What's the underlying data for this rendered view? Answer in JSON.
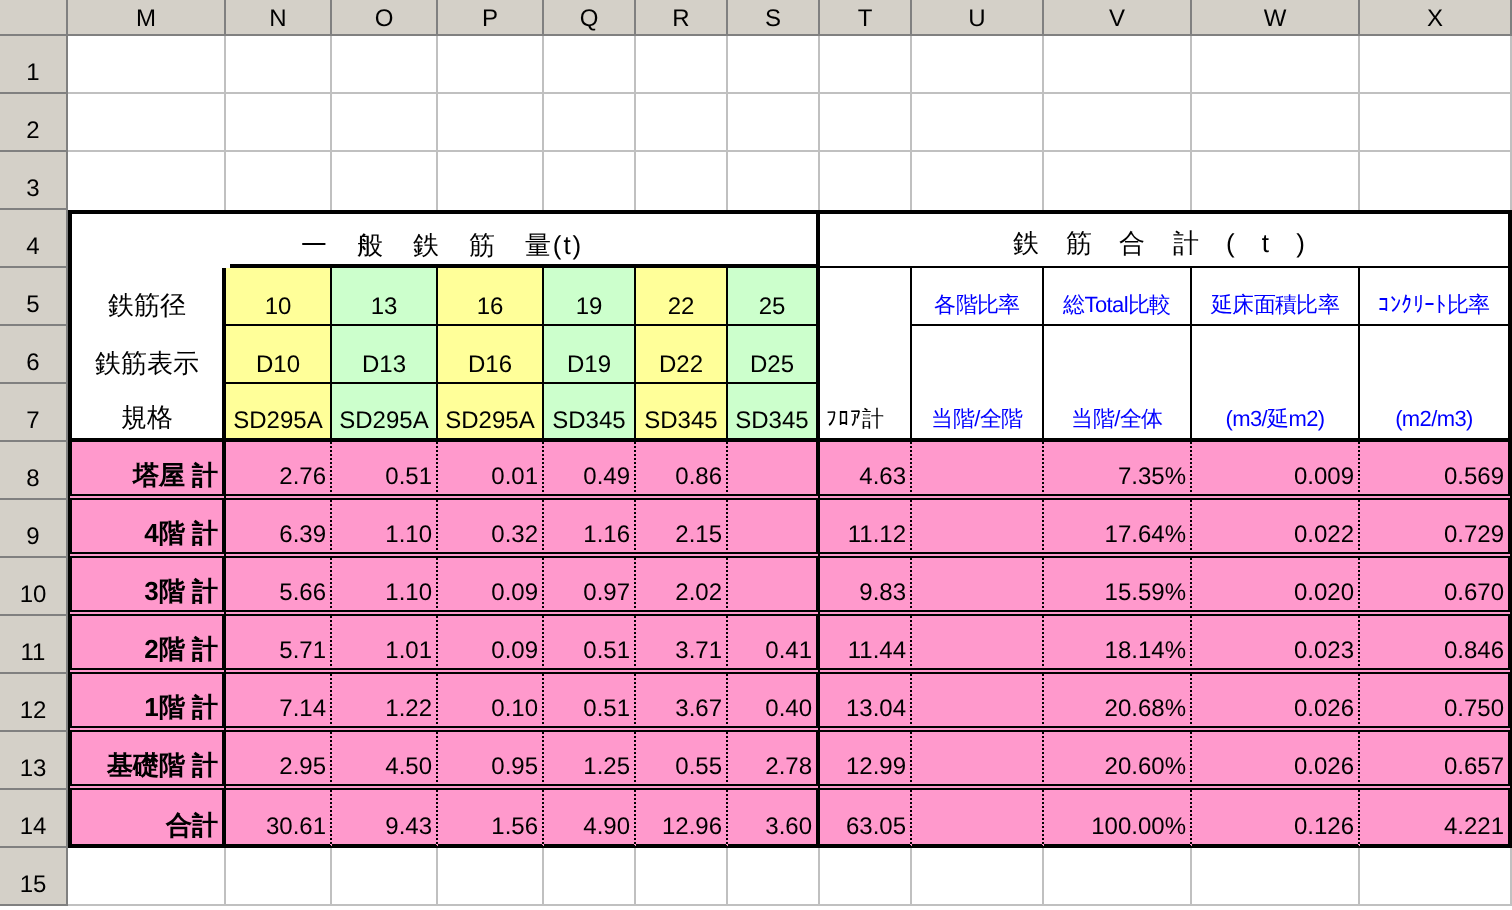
{
  "column_headers": [
    "M",
    "N",
    "O",
    "P",
    "Q",
    "R",
    "S",
    "T",
    "U",
    "V",
    "W",
    "X"
  ],
  "row_headers": [
    "1",
    "2",
    "3",
    "4",
    "5",
    "6",
    "7",
    "8",
    "9",
    "10",
    "11",
    "12",
    "13",
    "14",
    "15"
  ],
  "general_rebar": {
    "title": "一　般　鉄　筋　量(t)",
    "header_labels": [
      "鉄筋径",
      "鉄筋表示",
      "規格"
    ],
    "bars": [
      {
        "diameter": "10",
        "mark": "D10",
        "grade": "SD295A",
        "color": "#ffff99"
      },
      {
        "diameter": "13",
        "mark": "D13",
        "grade": "SD295A",
        "color": "#ccffcc"
      },
      {
        "diameter": "16",
        "mark": "D16",
        "grade": "SD295A",
        "color": "#ffff99"
      },
      {
        "diameter": "19",
        "mark": "D19",
        "grade": "SD345",
        "color": "#ccffcc"
      },
      {
        "diameter": "22",
        "mark": "D22",
        "grade": "SD345",
        "color": "#ffff99"
      },
      {
        "diameter": "25",
        "mark": "D25",
        "grade": "SD345",
        "color": "#ccffcc"
      }
    ]
  },
  "rebar_total": {
    "title": "鉄 筋 合 計 ( t )",
    "floor_total_label": "ﾌﾛｱ計",
    "ratios": [
      {
        "name": "各階比率",
        "unit": "当階/全階"
      },
      {
        "name": "総Total比較",
        "unit": "当階/全体"
      },
      {
        "name": "延床面積比率",
        "unit": "(m3/延m2)"
      },
      {
        "name": "ｺﾝｸﾘｰﾄ比率",
        "unit": "(m2/m3)"
      }
    ]
  },
  "floors": [
    {
      "label": "塔屋 計",
      "quantities": [
        "2.76",
        "0.51",
        "0.01",
        "0.49",
        "0.86"
      ],
      "floor_total": "4.63",
      "total_ratio": "7.35%",
      "area_ratio": "0.009",
      "concrete_ratio": "0.569"
    },
    {
      "label": "4階 計",
      "quantities": [
        "6.39",
        "1.10",
        "0.32",
        "1.16",
        "2.15"
      ],
      "floor_total": "11.12",
      "total_ratio": "17.64%",
      "area_ratio": "0.022",
      "concrete_ratio": "0.729"
    },
    {
      "label": "3階 計",
      "quantities": [
        "5.66",
        "1.10",
        "0.09",
        "0.97",
        "2.02"
      ],
      "floor_total": "9.83",
      "total_ratio": "15.59%",
      "area_ratio": "0.020",
      "concrete_ratio": "0.670"
    },
    {
      "label": "2階 計",
      "quantities": [
        "5.71",
        "1.01",
        "0.09",
        "0.51",
        "3.71",
        "0.41"
      ],
      "floor_total": "11.44",
      "total_ratio": "18.14%",
      "area_ratio": "0.023",
      "concrete_ratio": "0.846"
    },
    {
      "label": "1階 計",
      "quantities": [
        "7.14",
        "1.22",
        "0.10",
        "0.51",
        "3.67",
        "0.40"
      ],
      "floor_total": "13.04",
      "total_ratio": "20.68%",
      "area_ratio": "0.026",
      "concrete_ratio": "0.750"
    },
    {
      "label": "基礎階 計",
      "quantities": [
        "2.95",
        "4.50",
        "0.95",
        "1.25",
        "0.55",
        "2.78"
      ],
      "floor_total": "12.99",
      "total_ratio": "20.60%",
      "area_ratio": "0.026",
      "concrete_ratio": "0.657"
    },
    {
      "label": "合計",
      "quantities": [
        "30.61",
        "9.43",
        "1.56",
        "4.90",
        "12.96",
        "3.60"
      ],
      "floor_total": "63.05",
      "total_ratio": "100.00%",
      "area_ratio": "0.126",
      "concrete_ratio": "4.221"
    }
  ]
}
